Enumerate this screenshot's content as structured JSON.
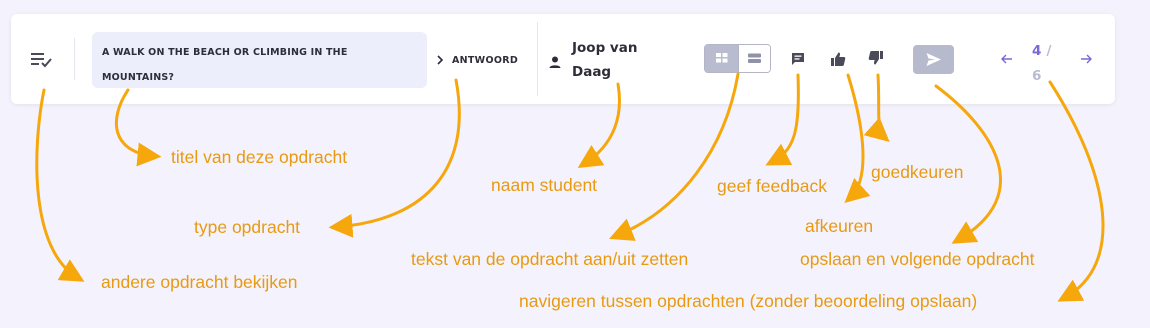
{
  "toolbar": {
    "assignment_title": "A WALK ON THE BEACH OR CLIMBING IN THE MOUNTAINS?",
    "assignment_type": "ANTWOORD",
    "student_name": "Joop van Daag",
    "pagination": {
      "current": "4",
      "separator": "/",
      "total": "6"
    }
  },
  "annotations": {
    "title": "titel van deze opdracht",
    "type": "type opdracht",
    "other": "andere opdracht bekijken",
    "student": "naam student",
    "toggle_text": "tekst van de opdracht aan/uit zetten",
    "feedback": "geef feedback",
    "approve": "goedkeuren",
    "reject": "afkeuren",
    "save_next": "opslaan en volgende opdracht",
    "navigate": "navigeren tussen opdrachten (zonder beoordeling opslaan)"
  },
  "colors": {
    "accent": "#7b67d8",
    "annotation": "#e89a12",
    "arrow": "#f5a70c",
    "icon": "#4a4a58",
    "disabled": "#b9bccf"
  },
  "icons": [
    "playlist-check-icon",
    "chevron-right-icon",
    "person-icon",
    "grid-view-icon",
    "list-view-icon",
    "comment-icon",
    "thumb-up-icon",
    "thumb-down-icon",
    "send-icon",
    "arrow-left-icon",
    "arrow-right-icon"
  ]
}
